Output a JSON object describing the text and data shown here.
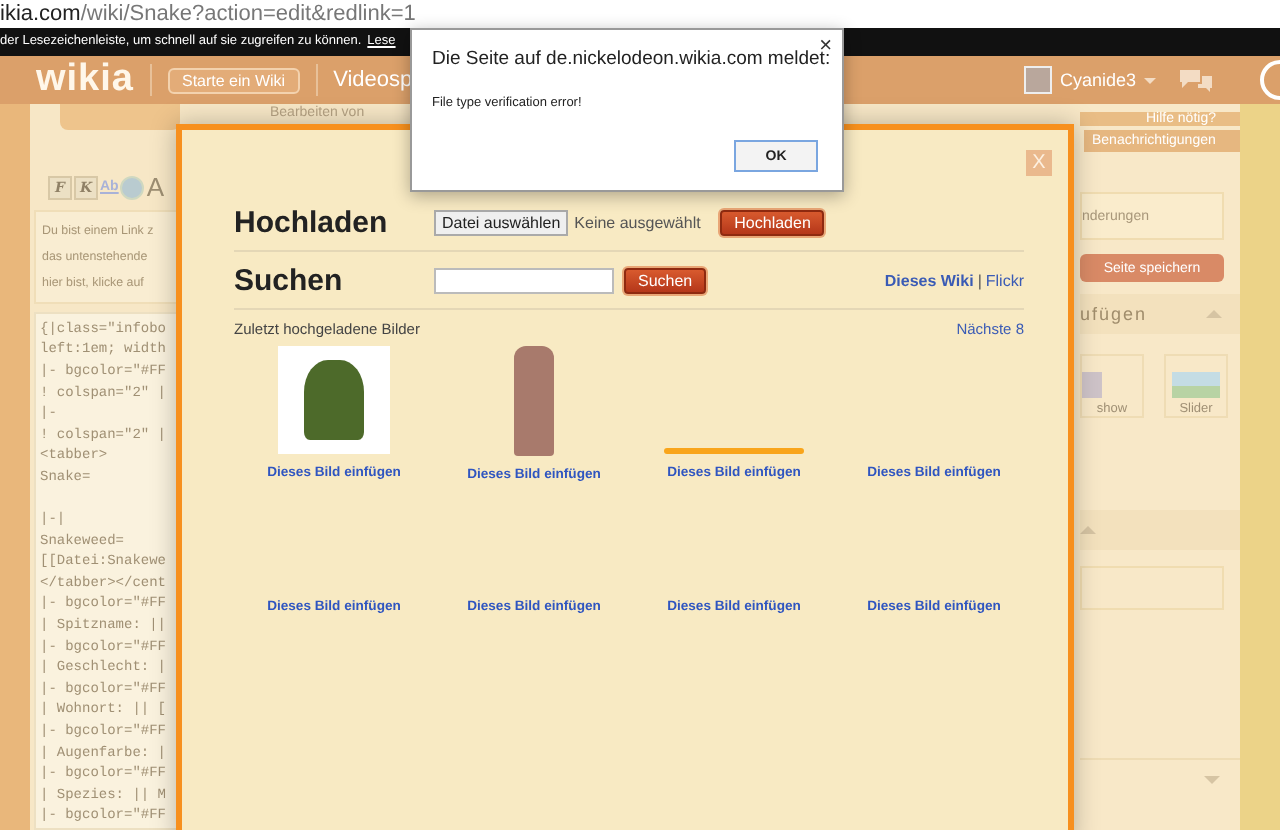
{
  "browser": {
    "url_host": "ikia.com",
    "url_path": "/wiki/Snake?action=edit&redlink=1",
    "bookmark_hint": "der Lesezeichenleiste, um schnell auf sie zugreifen zu können.",
    "bookmark_link": "Lese"
  },
  "header": {
    "logo": "wikia",
    "start_button": "Starte ein Wiki",
    "nav_item": "Videosp",
    "user": "Cyanide3"
  },
  "editor": {
    "page_heading": "Bearbeiten von",
    "toolbar": [
      {
        "kind": "text",
        "label": "F"
      },
      {
        "kind": "text",
        "label": "K"
      },
      {
        "kind": "link",
        "label": "Ab"
      },
      {
        "kind": "globe"
      },
      {
        "kind": "large",
        "label": "A"
      }
    ],
    "notice": [
      "Du bist einem Link z",
      "das untenstehende",
      "hier bist, klicke auf"
    ],
    "code_blocks": [
      [
        "{|class=\"infobo",
        "left:1em; width",
        "|- bgcolor=\"#FF",
        "! colspan=\"2\" |",
        "|-",
        "! colspan=\"2\" |",
        "<tabber>",
        "Snake="
      ],
      [
        "|-|",
        "Snakeweed=",
        "[[Datei:Snakewe",
        "</tabber></cent",
        "|- bgcolor=\"#FF",
        "| Spitzname: ||",
        "|- bgcolor=\"#FF",
        "| Geschlecht: |",
        "|- bgcolor=\"#FF",
        "| Wohnort: || [",
        "|- bgcolor=\"#FF",
        "| Augenfarbe: |",
        "|- bgcolor=\"#FF",
        "| Spezies: || M",
        "|- bgcolor=\"#FF"
      ]
    ]
  },
  "sidebar": {
    "help": "Hilfe nötig?",
    "notifications": "Benachrichtigungen",
    "summary_field": "nderungen",
    "save_button": "Seite speichern",
    "section": "ufügen",
    "tiles": [
      "show",
      "Slider"
    ]
  },
  "upload_dialog": {
    "close": "X",
    "upload_title": "Hochladen",
    "file_button": "Datei auswählen",
    "file_status": "Keine ausgewählt",
    "upload_button": "Hochladen",
    "search_title": "Suchen",
    "search_button": "Suchen",
    "sources": [
      "Dieses Wiki",
      "Flickr"
    ],
    "separator": "|",
    "recent_label": "Zuletzt hochgeladene Bilder",
    "next_link": "Nächste 8",
    "images": [
      {
        "kind": "photo",
        "link": "Dieses Bild einfügen"
      },
      {
        "kind": "portrait",
        "link": "Dieses Bild einfügen"
      },
      {
        "kind": "banner",
        "link": "Dieses Bild einfügen"
      },
      {
        "kind": "empty",
        "link": "Dieses Bild einfügen"
      },
      {
        "kind": "empty",
        "link": "Dieses Bild einfügen"
      },
      {
        "kind": "empty",
        "link": "Dieses Bild einfügen"
      },
      {
        "kind": "empty",
        "link": "Dieses Bild einfügen"
      },
      {
        "kind": "empty",
        "link": "Dieses Bild einfügen"
      }
    ]
  },
  "alert": {
    "title": "Die Seite auf de.nickelodeon.wikia.com meldet:",
    "close": "×",
    "message": "File type verification error!",
    "ok_button": "OK"
  }
}
